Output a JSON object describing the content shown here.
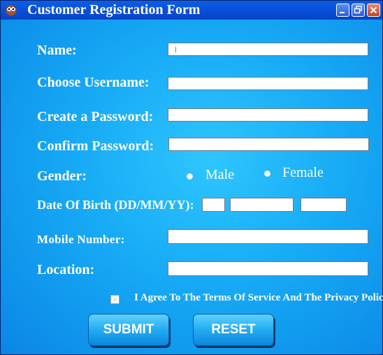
{
  "window": {
    "title": "Customer Registration Form",
    "controls": {
      "minimize": "minimize",
      "restore": "restore",
      "close": "close"
    }
  },
  "form": {
    "name_label": "Name:",
    "username_label": "Choose Username:",
    "password_label": "Create a Password:",
    "confirm_password_label": "Confirm Password:",
    "gender_label": "Gender:",
    "gender_options": [
      "Male",
      "Female"
    ],
    "dob_label": "Date Of Birth (DD/MM/YY):",
    "mobile_label": "Mobile Number:",
    "location_label": "Location:",
    "terms_label": "I Agree To The Terms Of Service And The Privacy Policy.",
    "name_value": "",
    "username_value": "",
    "password_value": "",
    "confirm_password_value": "",
    "dob_day_value": "",
    "dob_month_value": "",
    "dob_year_value": "",
    "mobile_value": "",
    "location_value": ""
  },
  "buttons": {
    "submit": "SUBMIT",
    "reset": "RESET"
  },
  "colors": {
    "background": "#17aaf5",
    "titlebar": "#0a4fd8",
    "label_text": "#ffffff",
    "button": "#27aff3"
  },
  "icons": {
    "app_icon": "owl-app-icon",
    "minimize": "minimize-icon",
    "restore": "restore-icon",
    "close": "close-icon"
  }
}
